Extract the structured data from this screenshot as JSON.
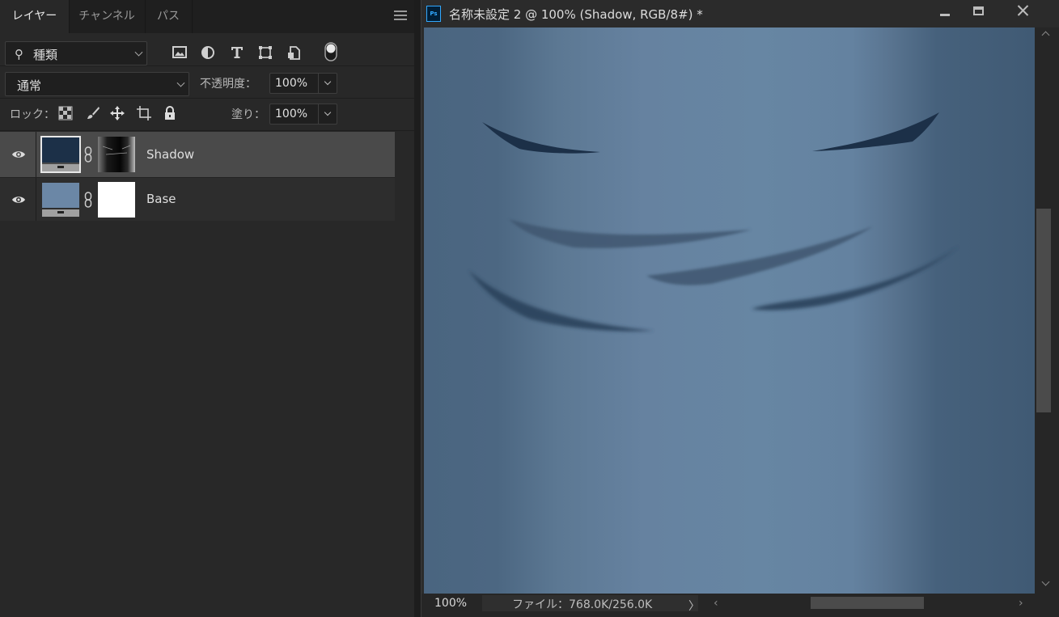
{
  "layers_panel": {
    "tabs": [
      {
        "label": "レイヤー",
        "active": true
      },
      {
        "label": "チャンネル",
        "active": false
      },
      {
        "label": "パス",
        "active": false
      }
    ],
    "filter": {
      "search_glyph": "⚲",
      "kind_label": "種類"
    },
    "filter_icons": [
      "image-filter-icon",
      "adjustment-filter-icon",
      "type-filter-icon",
      "shape-filter-icon",
      "smart-object-filter-icon",
      "filter-toggle-icon"
    ],
    "blend_mode": "通常",
    "opacity": {
      "label": "不透明度：",
      "value": "100%"
    },
    "lock": {
      "label": "ロック：",
      "icons": [
        "lock-transparent-icon",
        "lock-image-icon",
        "lock-position-icon",
        "lock-artboard-icon",
        "lock-all-icon"
      ]
    },
    "fill": {
      "label": "塗り：",
      "value": "100%"
    },
    "layers": [
      {
        "name": "Shadow",
        "selected": true,
        "color": "#1c3048",
        "mask": "gradient-black"
      },
      {
        "name": "Base",
        "selected": false,
        "color": "#6b87a6",
        "mask": "white"
      }
    ]
  },
  "document": {
    "app_badge": "Ps",
    "title": "名称未設定 2 @ 100% (Shadow, RGB/8#) *",
    "window_controls": [
      "minimize",
      "maximize",
      "close"
    ],
    "canvas_colors": {
      "base": "#6786a3",
      "edge": "#405a74",
      "shadow_stroke": "#1c3048",
      "faint_stroke": "#3f5670"
    },
    "status": {
      "zoom": "100%",
      "file_info": "ファイル：768.0K/256.0K",
      "arrow": "〉"
    }
  }
}
